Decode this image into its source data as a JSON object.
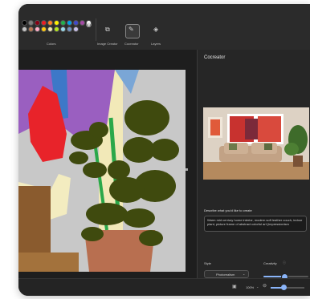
{
  "toolbar": {
    "colors_label": "Colors",
    "image_creator_label": "Image Creator",
    "cocreator_label": "Cocreator",
    "layers_label": "Layers",
    "swatches": [
      "#000000",
      "#7f7f7f",
      "#880015",
      "#ed1c24",
      "#ff7f27",
      "#fff200",
      "#22b14c",
      "#00a2e8",
      "#3f48cc",
      "#a349a4",
      "#ffffff",
      "#c3c3c3",
      "#b97a57",
      "#ffaec9",
      "#ffc90e",
      "#efe4b0",
      "#b5e61d",
      "#99d9ea",
      "#7092be",
      "#c8bfe7"
    ]
  },
  "panel": {
    "title": "Cocreator",
    "prompt_label": "Describe what you'd like to create",
    "prompt_text": "Warm mid century home interior, modern soft leather couch, indoor plant, picture frame of abstract colorful art (impressionism",
    "style_label": "Style",
    "style_value": "Photorealism",
    "creativity_label": "Creativity",
    "creativity_level": 0.45
  },
  "status": {
    "zoom": "100%",
    "zoom_level": 0.4
  },
  "colors": {
    "accent": "#8ab4f8",
    "plant_green": "#3f4a0e",
    "pot": "#b86f50"
  }
}
